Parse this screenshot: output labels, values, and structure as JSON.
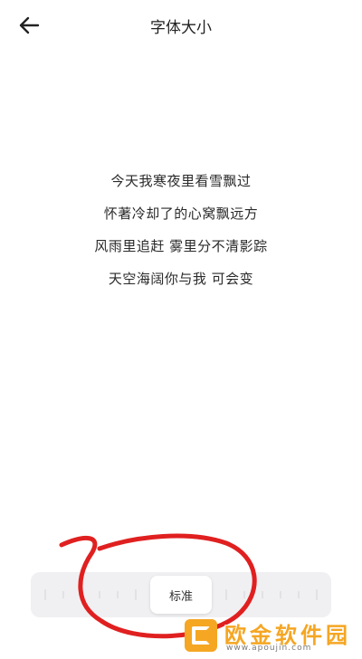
{
  "header": {
    "title": "字体大小",
    "back_icon": "arrow-left-icon"
  },
  "preview": {
    "lines": [
      "今天我寒夜里看雪飘过",
      "怀著冷却了的心窝飘远方",
      "风雨里追赶 雾里分不清影踪",
      "天空海阔你与我 可会变"
    ]
  },
  "font_size_slider": {
    "selected_label": "标准",
    "colors": {
      "track": "#f0f0f2",
      "thumb": "#ffffff",
      "tick": "#d4d4d8"
    }
  },
  "annotation": {
    "color": "#e02020"
  },
  "watermark": {
    "name": "欧金软件园",
    "url": "www.apoujin.com",
    "color": "#f5a623"
  }
}
